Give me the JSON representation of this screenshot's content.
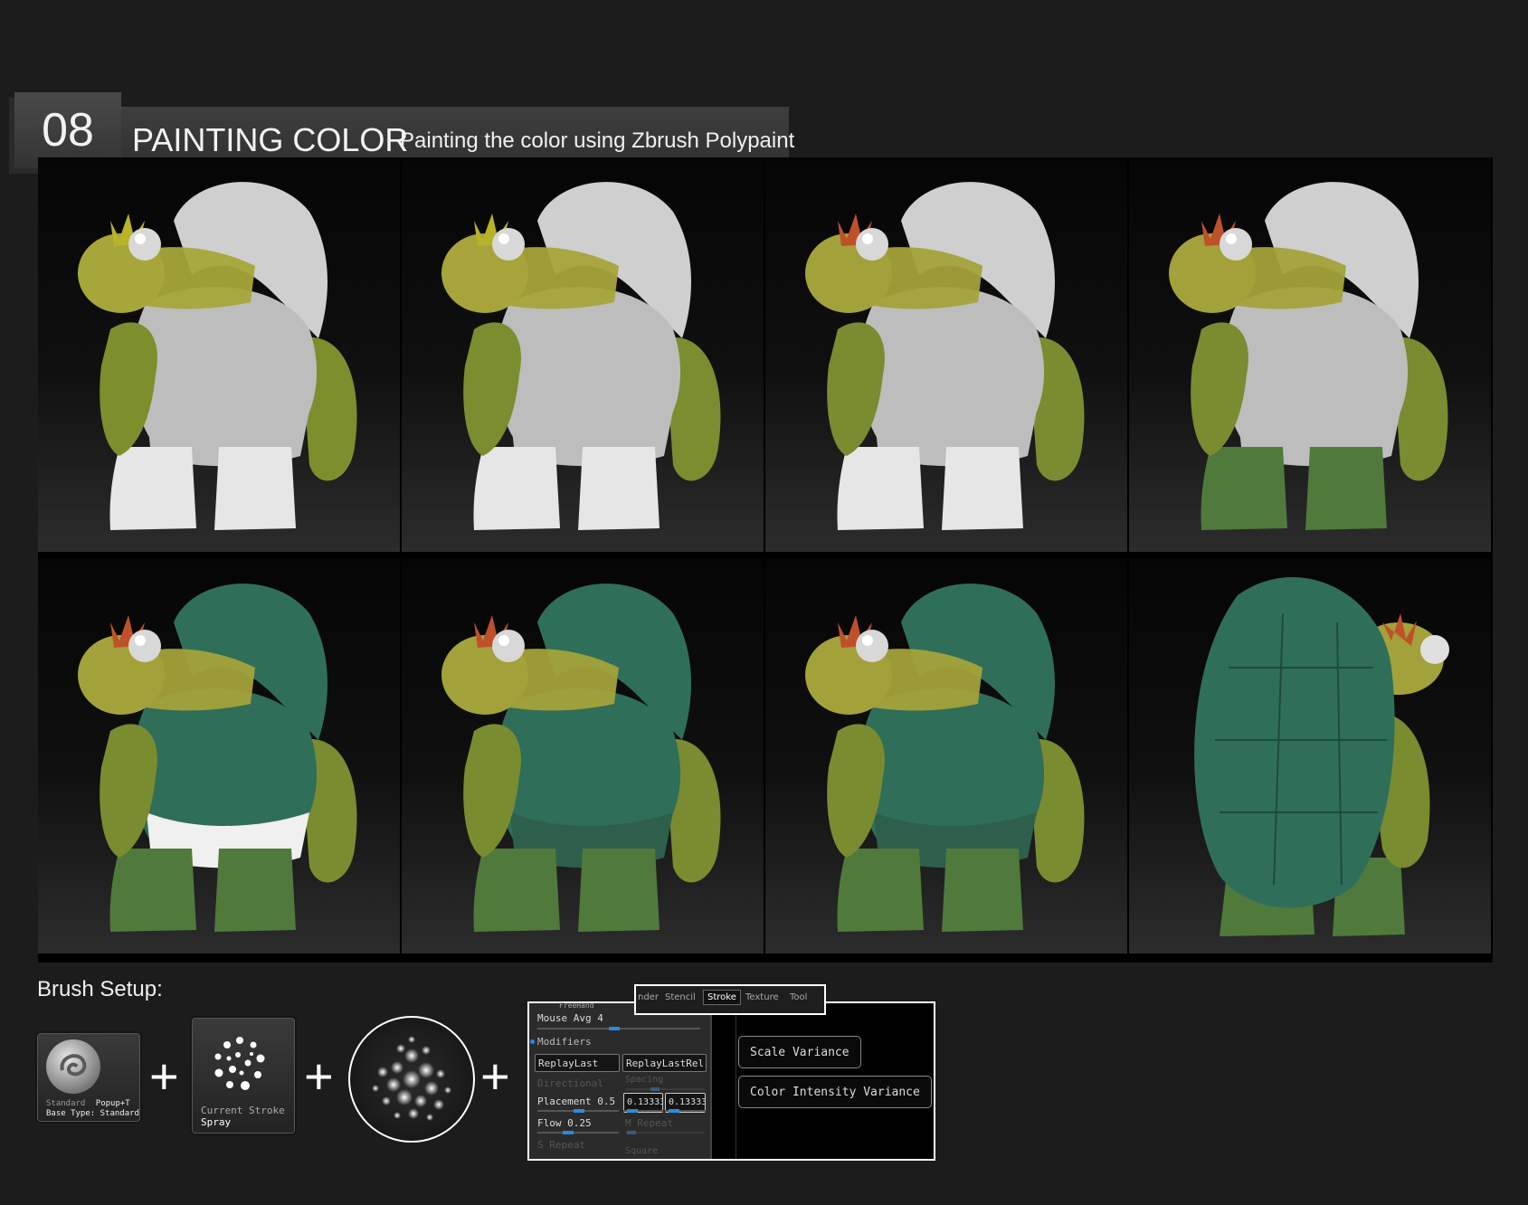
{
  "header": {
    "number": "08",
    "title": "PAINTING COLOR",
    "subtitle": "Painting the color using Zbrush Polypaint"
  },
  "gallery": {
    "panels": [
      {
        "step": 1,
        "view": "side",
        "shell": "#cfcfcf",
        "plastron": "#bdbdbd",
        "legs": "#e6e6e6",
        "skin": "#a7a63a",
        "arm": "#7c8f2c",
        "crest": "#b9b42a",
        "shorts": "#bdbdbd"
      },
      {
        "step": 2,
        "view": "side",
        "shell": "#cfcfcf",
        "plastron": "#bdbdbd",
        "legs": "#e6e6e6",
        "skin": "#a6a43a",
        "arm": "#7a8d2f",
        "crest": "#b7b22a",
        "shorts": "#bdbdbd"
      },
      {
        "step": 3,
        "view": "side",
        "shell": "#cfcfcf",
        "plastron": "#bdbdbd",
        "legs": "#e6e6e6",
        "skin": "#a3a23a",
        "arm": "#7a8c30",
        "crest": "#c0502a",
        "shorts": "#bdbdbd"
      },
      {
        "step": 4,
        "view": "side",
        "shell": "#cfcfcf",
        "plastron": "#bdbdbd",
        "legs": "#4f7a3c",
        "skin": "#a3a23a",
        "arm": "#7a8c30",
        "crest": "#c0502a",
        "shorts": "#bdbdbd"
      },
      {
        "step": 5,
        "view": "side",
        "shell": "#2f6f5a",
        "plastron": "#2f6e58",
        "legs": "#4f7a3c",
        "skin": "#a3a23a",
        "arm": "#7a8c30",
        "crest": "#c0502a",
        "shorts": "#f0f0f0"
      },
      {
        "step": 6,
        "view": "side",
        "shell": "#2f6f5a",
        "plastron": "#2f6e58",
        "legs": "#4f7a3c",
        "skin": "#a3a23a",
        "arm": "#7a8c30",
        "crest": "#c0502a",
        "shorts": "#2e5f4c"
      },
      {
        "step": 7,
        "view": "side",
        "shell": "#2f6f5a",
        "plastron": "#2f6e58",
        "legs": "#4f7a3c",
        "skin": "#a3a23a",
        "arm": "#7a8c30",
        "crest": "#c0502a",
        "shorts": "#2e5f4c"
      },
      {
        "step": 8,
        "view": "back",
        "shell": "#2f6f5a",
        "plastron": "#2f6e58",
        "legs": "#4f7a3c",
        "skin": "#a3a23a",
        "arm": "#7a8c30",
        "crest": "#c0502a",
        "shorts": "#2e5f4c"
      }
    ]
  },
  "brush_setup": {
    "label": "Brush Setup:",
    "plus": "+",
    "standard_tile": {
      "name": "Standard",
      "shortcut": "Popup+T",
      "base_type": "Base Type: Standard"
    },
    "stroke_tile": {
      "line1": "Current Stroke",
      "line2": "Spray"
    },
    "alpha_icon": "spray-alpha-icon"
  },
  "palette": {
    "tabs": [
      "nder",
      "Stencil",
      "Stroke",
      "Texture",
      "Tool"
    ],
    "active_tab": "Stroke",
    "freehand": "FreeHand",
    "mouse_avg": "Mouse Avg 4",
    "modifiers": "Modifiers",
    "replay_last": "ReplayLast",
    "replay_last_rel": "ReplayLastRel",
    "directional": "Directional",
    "spacing": "Spacing",
    "placement": "Placement 0.5",
    "placement_value_1": "0.13333",
    "placement_value_2": "0.13333",
    "flow": "Flow 0.25",
    "m_repeat": "M Repeat",
    "s_repeat": "S Repeat",
    "square": "Square",
    "scale_variance": "Scale Variance",
    "color_intensity_variance": "Color Intensity Variance"
  }
}
